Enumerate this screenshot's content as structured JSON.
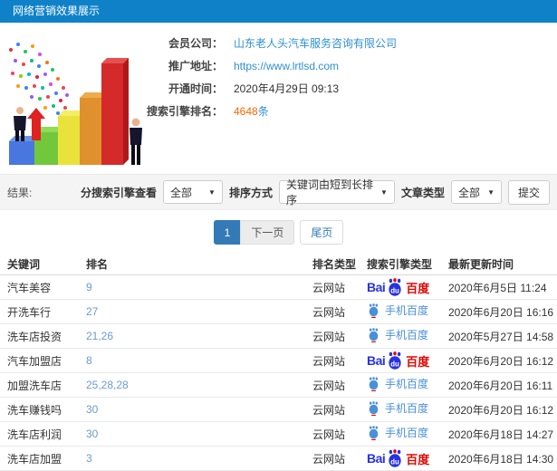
{
  "header": {
    "title": "网络营销效果展示"
  },
  "info": {
    "company_label": "会员公司：",
    "company_value": "山东老人头汽车服务咨询有限公司",
    "url_label": "推广地址：",
    "url_value": "https://www.lrtlsd.com",
    "open_label": "开通时间：",
    "open_value": "2020年4月29日 09:13",
    "rank_label": "搜索引擎排名：",
    "rank_count": "4648",
    "rank_unit": "条"
  },
  "filters": {
    "result_label": "结果:",
    "engine_label": "分搜索引擎查看",
    "engine_value": "全部",
    "sort_label": "排序方式",
    "sort_value": "关键词由短到长排序",
    "type_label": "文章类型",
    "type_value": "全部",
    "submit_label": "提交"
  },
  "pagination": {
    "current_page": "1",
    "next_label": "下一页",
    "last_label": "尾页"
  },
  "table": {
    "headers": [
      "关键词",
      "排名",
      "排名类型",
      "搜索引擎类型",
      "最新更新时间"
    ],
    "logo": {
      "bai": "Bai",
      "du": "du",
      "cn": "百度"
    },
    "engine_labels": {
      "mobile": "手机百度"
    },
    "rows": [
      {
        "keyword": "汽车美容",
        "rank": "9",
        "rank_type": "云网站",
        "engine": "baidu",
        "updated": "2020年6月5日 11:24"
      },
      {
        "keyword": "开洗车行",
        "rank": "27",
        "rank_type": "云网站",
        "engine": "mobile",
        "updated": "2020年6月20日 16:16"
      },
      {
        "keyword": "洗车店投资",
        "rank": "21,26",
        "rank_type": "云网站",
        "engine": "mobile",
        "updated": "2020年5月27日 14:58"
      },
      {
        "keyword": "汽车加盟店",
        "rank": "8",
        "rank_type": "云网站",
        "engine": "baidu",
        "updated": "2020年6月20日 16:12"
      },
      {
        "keyword": "加盟洗车店",
        "rank": "25,28,28",
        "rank_type": "云网站",
        "engine": "mobile",
        "updated": "2020年6月20日 16:11"
      },
      {
        "keyword": "洗车赚钱吗",
        "rank": "30",
        "rank_type": "云网站",
        "engine": "mobile",
        "updated": "2020年6月20日 16:12"
      },
      {
        "keyword": "洗车店利润",
        "rank": "30",
        "rank_type": "云网站",
        "engine": "mobile",
        "updated": "2020年6月18日 14:27"
      },
      {
        "keyword": "洗车店加盟",
        "rank": "3",
        "rank_type": "云网站",
        "engine": "baidu",
        "updated": "2020年6月18日 14:30"
      }
    ]
  },
  "colors": {
    "titlebar_bg": "#0f81c8",
    "link": "#2e8fd4",
    "count_orange": "#f60",
    "pagination_active": "#337ab7",
    "baidu_blue": "#2932e1",
    "baidu_red": "#e10601",
    "results_bar_bg": "#f4f4f4"
  }
}
